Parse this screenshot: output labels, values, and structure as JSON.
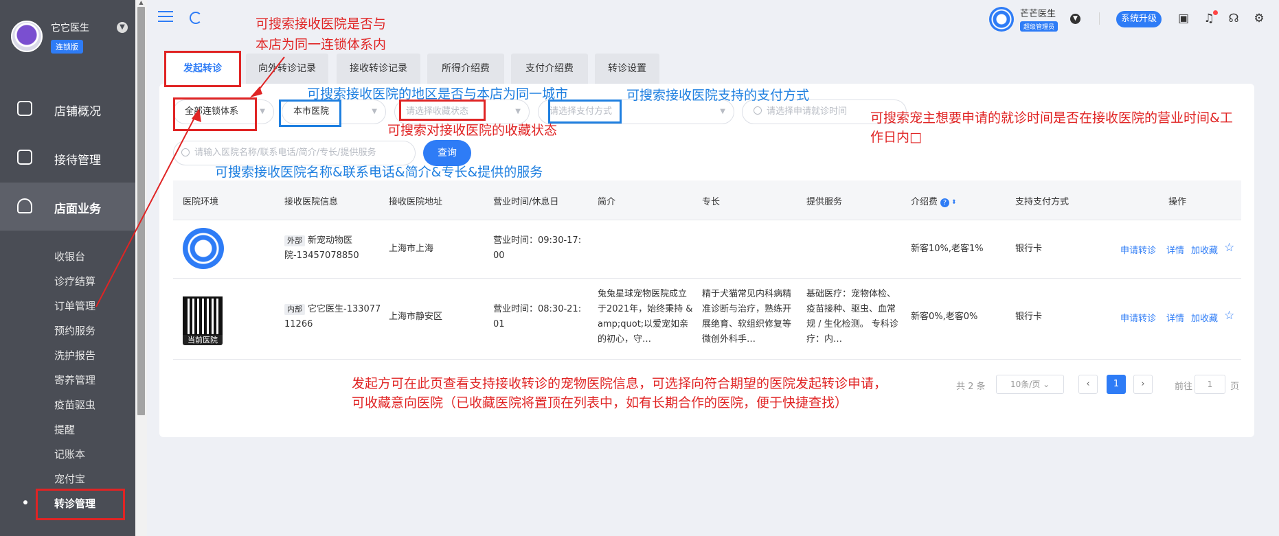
{
  "sidebar": {
    "shop_name": "它它医生",
    "edition": "连锁版",
    "main_items": [
      {
        "label": "店铺概况"
      },
      {
        "label": "接待管理"
      },
      {
        "label": "店面业务"
      }
    ],
    "sub_items": [
      {
        "label": "收银台"
      },
      {
        "label": "诊疗结算"
      },
      {
        "label": "订单管理"
      },
      {
        "label": "预约服务"
      },
      {
        "label": "洗护报告"
      },
      {
        "label": "寄养管理"
      },
      {
        "label": "疫苗驱虫"
      },
      {
        "label": "提醒"
      },
      {
        "label": "记账本"
      },
      {
        "label": "宠付宝"
      },
      {
        "label": "转诊管理"
      }
    ]
  },
  "header": {
    "user_name": "芒芒医生",
    "user_role": "超级管理员",
    "upgrade_label": "系统升级"
  },
  "tabs": [
    {
      "label": "发起转诊"
    },
    {
      "label": "向外转诊记录"
    },
    {
      "label": "接收转诊记录"
    },
    {
      "label": "所得介绍费"
    },
    {
      "label": "支付介绍费"
    },
    {
      "label": "转诊设置"
    }
  ],
  "filters": {
    "chain": "全部连锁体系",
    "city": "本市医院",
    "favorite_placeholder": "请选择收藏状态",
    "payment_placeholder": "请选择支付方式",
    "time_placeholder": "请选择申请就诊时间",
    "search_placeholder": "请输入医院名称/联系电话/简介/专长/提供服务",
    "query_label": "查询"
  },
  "table": {
    "columns": [
      "医院环境",
      "接收医院信息",
      "接收医院地址",
      "营业时间/休息日",
      "简介",
      "专长",
      "提供服务",
      "介绍费",
      "支持支付方式",
      "操作"
    ],
    "rows": [
      {
        "tag": "外部",
        "info": "新宠动物医院-13457078850",
        "address": "上海市上海",
        "hours": "营业时间：09:30-17:00",
        "intro": "",
        "specialty": "",
        "services": "",
        "fee": "新客10%,老客1%",
        "payment": "银行卡",
        "image_caption": ""
      },
      {
        "tag": "内部",
        "info": "它它医生-13307711266",
        "address": "上海市静安区",
        "hours": "营业时间：08:30-21:01",
        "intro": "兔兔星球宠物医院成立于2021年，始终秉持 &amp;quot;以爱宠如亲的初心，守…",
        "specialty": "精于犬猫常见内科病精准诊断与治疗，熟练开展绝育、软组织修复等微创外科手…",
        "services": "基础医疗：宠物体检、疫苗接种、驱虫、血常规 / 生化检测。 专科诊疗：内…",
        "fee": "新客0%,老客0%",
        "payment": "银行卡",
        "image_caption": "当前医院"
      }
    ],
    "actions": {
      "apply": "申请转诊",
      "detail": "详情",
      "favorite": "加收藏"
    }
  },
  "pagination": {
    "total": "共 2 条",
    "page_size": "10条/页",
    "current_page": "1",
    "goto_prefix": "前往",
    "goto_value": "1",
    "goto_suffix": "页"
  },
  "annotations": {
    "a1": "可搜索接收医院是否与",
    "a1b": "本店为同一连锁体系内",
    "a2": "可搜索接收医院的地区是否与本店为同一城市",
    "a3": "可搜索接收医院支持的支付方式",
    "a4": "可搜索对接收医院的收藏状态",
    "a5": "可搜索宠主想要申请的就诊时间是否在接收医院的营业时间&工",
    "a5b": "作日内□",
    "a6": "可搜索接收医院名称&联系电话&简介&专长&提供的服务",
    "a7": "发起方可在此页查看支持接收转诊的宠物医院信息，可选择向符合期望的医院发起转诊申请，",
    "a7b": "可收藏意向医院（已收藏医院将置顶在列表中，如有长期合作的医院，便于快捷查找）"
  }
}
